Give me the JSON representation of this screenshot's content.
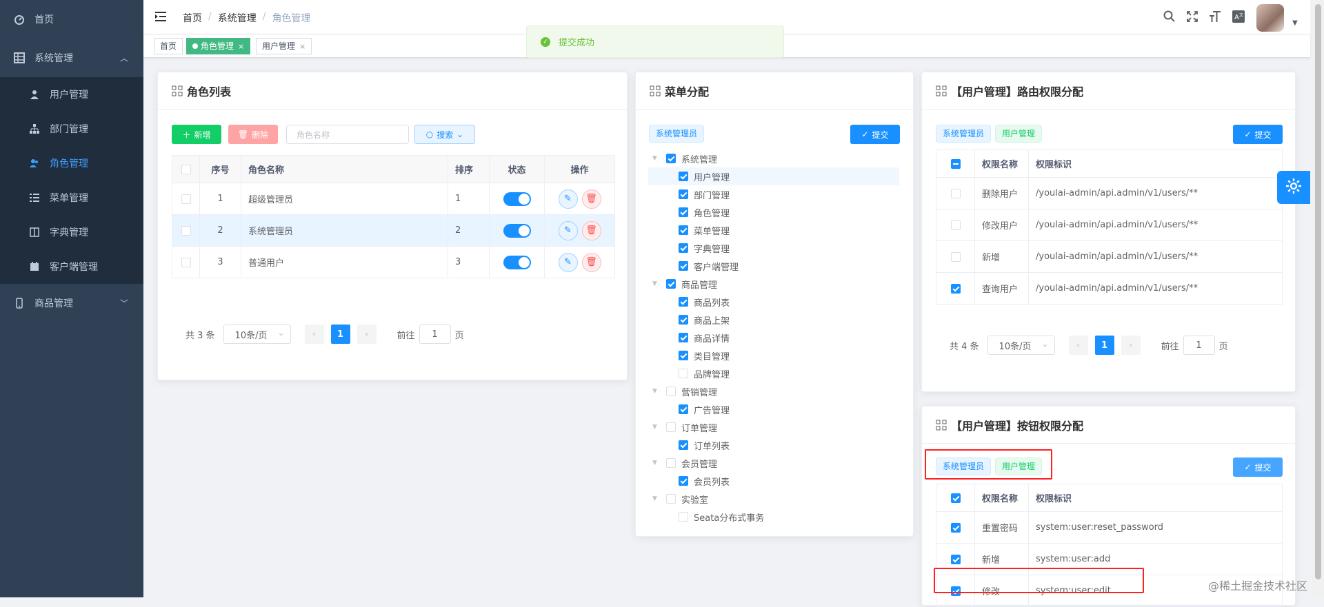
{
  "sidebar": {
    "home": "首页",
    "system": "系统管理",
    "sub": [
      "用户管理",
      "部门管理",
      "角色管理",
      "菜单管理",
      "字典管理",
      "客户端管理"
    ],
    "goods": "商品管理"
  },
  "breadcrumb": [
    "首页",
    "系统管理",
    "角色管理"
  ],
  "tags": [
    "首页",
    "角色管理",
    "用户管理"
  ],
  "message": "提交成功",
  "roleCard": {
    "title": "角色列表",
    "add": "新增",
    "del": "删除",
    "placeholder": "角色名称",
    "search": "搜索",
    "headers": [
      "序号",
      "角色名称",
      "排序",
      "状态",
      "操作"
    ],
    "rows": [
      {
        "idx": "1",
        "name": "超级管理员",
        "sort": "1"
      },
      {
        "idx": "2",
        "name": "系统管理员",
        "sort": "2"
      },
      {
        "idx": "3",
        "name": "普通用户",
        "sort": "3"
      }
    ],
    "pager": {
      "total": "共 3 条",
      "size": "10条/页",
      "page": "1",
      "goto": "前往",
      "gotoVal": "1",
      "unit": "页"
    }
  },
  "menuCard": {
    "title": "菜单分配",
    "tag": "系统管理员",
    "submit": "提交",
    "tree": [
      {
        "label": "系统管理",
        "lvl": 0,
        "checked": true
      },
      {
        "label": "用户管理",
        "lvl": 1,
        "checked": true
      },
      {
        "label": "部门管理",
        "lvl": 1,
        "checked": true
      },
      {
        "label": "角色管理",
        "lvl": 1,
        "checked": true
      },
      {
        "label": "菜单管理",
        "lvl": 1,
        "checked": true
      },
      {
        "label": "字典管理",
        "lvl": 1,
        "checked": true
      },
      {
        "label": "客户端管理",
        "lvl": 1,
        "checked": true
      },
      {
        "label": "商品管理",
        "lvl": 0,
        "checked": true
      },
      {
        "label": "商品列表",
        "lvl": 1,
        "checked": true
      },
      {
        "label": "商品上架",
        "lvl": 1,
        "checked": true
      },
      {
        "label": "商品详情",
        "lvl": 1,
        "checked": true
      },
      {
        "label": "类目管理",
        "lvl": 1,
        "checked": true
      },
      {
        "label": "品牌管理",
        "lvl": 1,
        "checked": false
      },
      {
        "label": "营销管理",
        "lvl": 0,
        "checked": false
      },
      {
        "label": "广告管理",
        "lvl": 1,
        "checked": true
      },
      {
        "label": "订单管理",
        "lvl": 0,
        "checked": false
      },
      {
        "label": "订单列表",
        "lvl": 1,
        "checked": true
      },
      {
        "label": "会员管理",
        "lvl": 0,
        "checked": false
      },
      {
        "label": "会员列表",
        "lvl": 1,
        "checked": true
      },
      {
        "label": "实验室",
        "lvl": 0,
        "checked": false
      },
      {
        "label": "Seata分布式事务",
        "lvl": 1,
        "checked": false
      }
    ]
  },
  "routeCard": {
    "title": "【用户管理】路由权限分配",
    "tags": [
      "系统管理员",
      "用户管理"
    ],
    "submit": "提交",
    "headers": [
      "权限名称",
      "权限标识"
    ],
    "rows": [
      {
        "name": "删除用户",
        "perm": "/youlai-admin/api.admin/v1/users/**",
        "checked": false
      },
      {
        "name": "修改用户",
        "perm": "/youlai-admin/api.admin/v1/users/**",
        "checked": false
      },
      {
        "name": "新增",
        "perm": "/youlai-admin/api.admin/v1/users/**",
        "checked": false
      },
      {
        "name": "查询用户",
        "perm": "/youlai-admin/api.admin/v1/users/**",
        "checked": true
      }
    ],
    "pager": {
      "total": "共 4 条",
      "size": "10条/页",
      "page": "1",
      "goto": "前往",
      "gotoVal": "1",
      "unit": "页"
    }
  },
  "btnCard": {
    "title": "【用户管理】按钮权限分配",
    "tags": [
      "系统管理员",
      "用户管理"
    ],
    "submit": "提交",
    "headers": [
      "权限名称",
      "权限标识"
    ],
    "rows": [
      {
        "name": "重置密码",
        "perm": "system:user:reset_password"
      },
      {
        "name": "新增",
        "perm": "system:user:add"
      },
      {
        "name": "修改",
        "perm": "system:user:edit"
      }
    ]
  },
  "watermark": "@稀土掘金技术社区",
  "colors": {
    "sidebar": "#304156",
    "primary": "#1890ff",
    "success": "#13ce66",
    "tagsActive": "#42b983",
    "highlight": "#ff2020"
  }
}
